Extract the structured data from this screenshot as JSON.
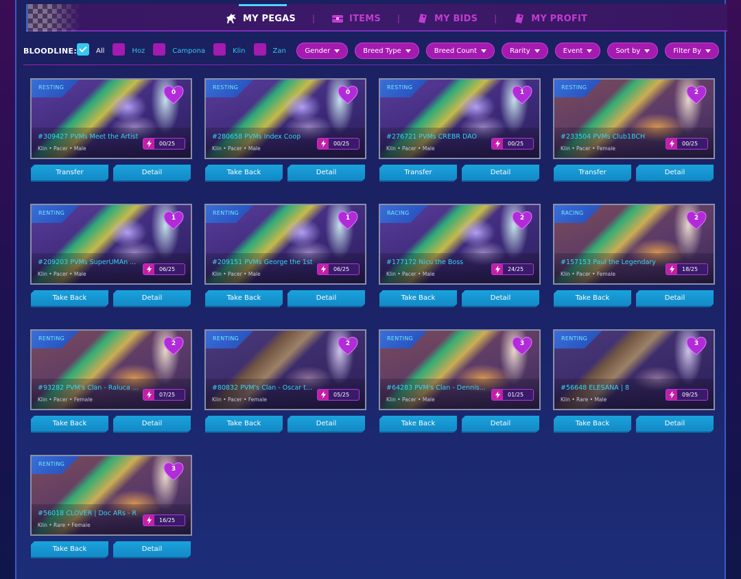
{
  "nav": {
    "tabs": [
      {
        "label": "MY PEGAS",
        "active": true,
        "icon": "horse-icon"
      },
      {
        "label": "ITEMS",
        "active": false,
        "icon": "chest-icon"
      },
      {
        "label": "MY BIDS",
        "active": false,
        "icon": "tag-icon"
      },
      {
        "label": "MY PROFIT",
        "active": false,
        "icon": "tag-icon"
      }
    ]
  },
  "filters": {
    "bloodline_label": "BLOODLINE:",
    "bloodlines": [
      {
        "label": "All",
        "checked": true
      },
      {
        "label": "Hoz",
        "checked": false
      },
      {
        "label": "Campona",
        "checked": false
      },
      {
        "label": "Klin",
        "checked": false
      },
      {
        "label": "Zan",
        "checked": false
      }
    ],
    "dropdowns": [
      "Gender",
      "Breed Type",
      "Breed Count",
      "Rarity",
      "Event",
      "Sort by",
      "Filter By"
    ]
  },
  "colors": {
    "accent_cyan": "#35c8ef",
    "accent_magenta": "#a51ab0",
    "button_blue": "#1aa3dc"
  },
  "cards": [
    {
      "status": "RESTING",
      "hearts": "0",
      "name": "#309427 PVMs Meet the Artist",
      "bloodline": "Klin",
      "breed": "Pacer",
      "gender": "Male",
      "energy": "00/25",
      "primary": "Transfer",
      "secondary": "Detail",
      "art": "cool"
    },
    {
      "status": "RESTING",
      "hearts": "0",
      "name": "#280658 PVMs Index Coop",
      "bloodline": "Klin",
      "breed": "Pacer",
      "gender": "Male",
      "energy": "00/25",
      "primary": "Take Back",
      "secondary": "Detail",
      "art": "cool"
    },
    {
      "status": "RESTING",
      "hearts": "1",
      "name": "#276721 PVMs CREBR DAO",
      "bloodline": "Klin",
      "breed": "Pacer",
      "gender": "Male",
      "energy": "00/25",
      "primary": "Transfer",
      "secondary": "Detail",
      "art": "cool"
    },
    {
      "status": "RESTING",
      "hearts": "2",
      "name": "#233504 PVMs Club1BCH",
      "bloodline": "Klin",
      "breed": "Pacer",
      "gender": "Female",
      "energy": "00/25",
      "primary": "Transfer",
      "secondary": "Detail",
      "art": "warm"
    },
    {
      "status": "RENTING",
      "hearts": "1",
      "name": "#209203 PVMs SuperUMAn ...",
      "bloodline": "Klin",
      "breed": "Pacer",
      "gender": "Male",
      "energy": "06/25",
      "primary": "Take Back",
      "secondary": "Detail",
      "art": "cool"
    },
    {
      "status": "RENTING",
      "hearts": "1",
      "name": "#209151 PVMs George the 1st",
      "bloodline": "Klin",
      "breed": "Pacer",
      "gender": "Male",
      "energy": "06/25",
      "primary": "Take Back",
      "secondary": "Detail",
      "art": "cool"
    },
    {
      "status": "RACING",
      "hearts": "2",
      "name": "#177172 Nicu the Boss",
      "bloodline": "Klin",
      "breed": "Pacer",
      "gender": "Male",
      "energy": "24/25",
      "primary": "Take Back",
      "secondary": "Detail",
      "art": "cool"
    },
    {
      "status": "RACING",
      "hearts": "2",
      "name": "#157153 Paul the Legendary",
      "bloodline": "Klin",
      "breed": "Pacer",
      "gender": "Female",
      "energy": "18/25",
      "primary": "Take Back",
      "secondary": "Detail",
      "art": "warm"
    },
    {
      "status": "RENTING",
      "hearts": "2",
      "name": "#93282 PVM's Clan - Raluca ...",
      "bloodline": "Klin",
      "breed": "Pacer",
      "gender": "Female",
      "energy": "07/25",
      "primary": "Take Back",
      "secondary": "Detail",
      "art": "warm"
    },
    {
      "status": "RENTING",
      "hearts": "2",
      "name": "#80832 PVM's Clan - Oscar t...",
      "bloodline": "Klin",
      "breed": "Pacer",
      "gender": "Female",
      "energy": "05/25",
      "primary": "Take Back",
      "secondary": "Detail",
      "art": "brown"
    },
    {
      "status": "RENTING",
      "hearts": "3",
      "name": "#64283 PVM's Clan - Dennis...",
      "bloodline": "Klin",
      "breed": "Pacer",
      "gender": "Male",
      "energy": "01/25",
      "primary": "Take Back",
      "secondary": "Detail",
      "art": "warm"
    },
    {
      "status": "RENTING",
      "hearts": "3",
      "name": "#56648 ELESANA | 8",
      "bloodline": "Klin",
      "breed": "Rare",
      "gender": "Male",
      "energy": "09/25",
      "primary": "Take Back",
      "secondary": "Detail",
      "art": "brown"
    },
    {
      "status": "RENTING",
      "hearts": "3",
      "name": "#56018 CLOVER | Doc ARs - R",
      "bloodline": "Klin",
      "breed": "Rare",
      "gender": "Female",
      "energy": "16/25",
      "primary": "Take Back",
      "secondary": "Detail",
      "art": "warm"
    }
  ]
}
